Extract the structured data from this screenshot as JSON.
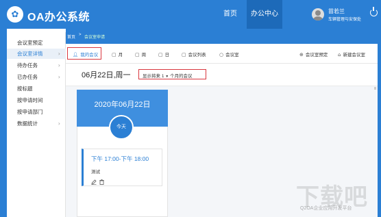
{
  "header": {
    "logo_glyph": "✿",
    "app_title": "OA办公系统",
    "nav": [
      "首页",
      "办公中心"
    ],
    "user_name": "苗若兰",
    "user_dept": "车辆管理与安保处"
  },
  "breadcrumb": {
    "home": "首页",
    "separator": ">",
    "current": "会议室申请"
  },
  "sidebar": {
    "items": [
      {
        "label": "会议室预定",
        "has_arrow": false
      },
      {
        "label": "会议室详情",
        "has_arrow": true,
        "active": true
      },
      {
        "label": "待办任务",
        "has_arrow": true
      },
      {
        "label": "已办任务",
        "has_arrow": true
      },
      {
        "label": "按标题",
        "has_arrow": false
      },
      {
        "label": "按申请时间",
        "has_arrow": false
      },
      {
        "label": "按申请部门",
        "has_arrow": false
      },
      {
        "label": "数据统计",
        "has_arrow": true
      }
    ],
    "arrow": "›"
  },
  "toolbar": {
    "my_meetings": "我的会议",
    "month": "月",
    "week": "周",
    "day": "日",
    "meeting_list": "会议列表",
    "meeting_room": "会议室",
    "reserve": "会议室预定",
    "new_room": "新建会议室"
  },
  "date_row": {
    "date": "06月22日,周一",
    "range_prefix": "显示将来",
    "range_value": "1",
    "range_suffix": "个月的会议"
  },
  "day_card": {
    "date": "2020年06月22日",
    "today": "今天"
  },
  "event": {
    "time": "下午 17:00-下午 18:00",
    "title": "测试"
  },
  "watermark": {
    "big": "下载吧",
    "small": "Q2OA企业应用开发平台"
  },
  "colors": {
    "brand": "#2b7fd4",
    "highlight_box": "#d9363e"
  }
}
